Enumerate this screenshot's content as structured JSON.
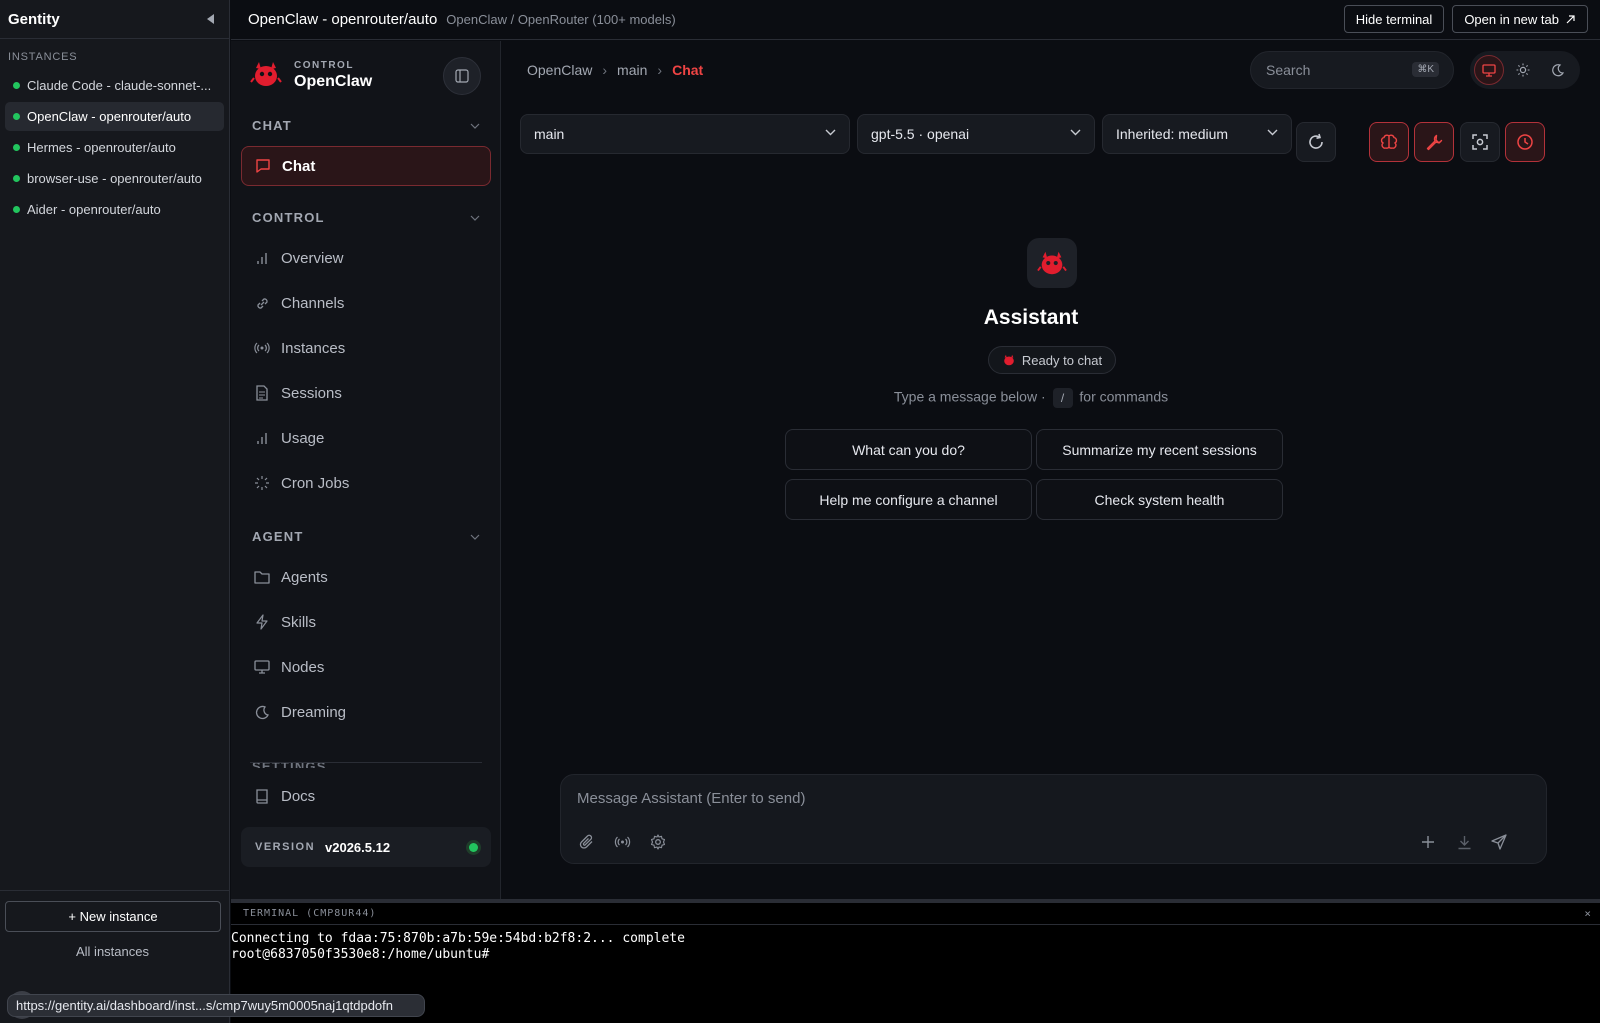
{
  "gentity": {
    "brand": "Gentity",
    "section_label": "INSTANCES",
    "instances": [
      {
        "label": "Claude Code - claude-sonnet-..."
      },
      {
        "label": "OpenClaw - openrouter/auto"
      },
      {
        "label": "Hermes - openrouter/auto"
      },
      {
        "label": "browser-use - openrouter/auto"
      },
      {
        "label": "Aider - openrouter/auto"
      }
    ],
    "new_instance": "+ New instance",
    "all_instances": "All instances"
  },
  "topbar": {
    "title": "OpenClaw - openrouter/auto",
    "subtitle": "OpenClaw / OpenRouter (100+ models)",
    "hide_terminal": "Hide terminal",
    "open_new_tab": "Open in new tab"
  },
  "nav": {
    "control_small": "CONTROL",
    "app_name": "OpenClaw",
    "groups": {
      "chat": "CHAT",
      "control": "CONTROL",
      "agent": "AGENT",
      "settings": "SETTINGS"
    },
    "items": {
      "chat": "Chat",
      "overview": "Overview",
      "channels": "Channels",
      "instances": "Instances",
      "sessions": "Sessions",
      "usage": "Usage",
      "cron_jobs": "Cron Jobs",
      "agents": "Agents",
      "skills": "Skills",
      "nodes": "Nodes",
      "dreaming": "Dreaming",
      "docs": "Docs"
    },
    "version_label": "VERSION",
    "version_value": "v2026.5.12"
  },
  "main": {
    "breadcrumb": [
      "OpenClaw",
      "main",
      "Chat"
    ],
    "search_placeholder": "Search",
    "search_shortcut": "⌘K",
    "session_select": "main",
    "model_select": "gpt-5.5 · openai",
    "thinking_select": "Inherited: medium",
    "divider_char": "|",
    "assistant_name": "Assistant",
    "ready_text": "Ready to chat",
    "hint_before": "Type a message below ·",
    "hint_key": "/",
    "hint_after": "for commands",
    "suggestions": [
      "What can you do?",
      "Summarize my recent sessions",
      "Help me configure a channel",
      "Check system health"
    ],
    "composer_placeholder": "Message Assistant (Enter to send)"
  },
  "terminal": {
    "header": "TERMINAL (CMP8UR44)",
    "close": "×",
    "lines": [
      "Connecting to fdaa:75:870b:a7b:59e:54bd:b2f8:2... complete",
      "root@6837050f3530e8:/home/ubuntu#"
    ]
  },
  "statusbar": {
    "url": "https://gentity.ai/dashboard/inst...s/cmp7wuy5m0005naj1qtdpdofn"
  },
  "colors": {
    "accent": "#ef4444",
    "online": "#22c55e",
    "background": "#0b0d12"
  },
  "icons": {
    "collapse": "triangle-left-icon",
    "sidebar_toggle": "sidebar-panel-icon",
    "chat": "message-square-icon",
    "overview": "bar-chart-icon",
    "channels": "link-icon",
    "instances": "broadcast-icon",
    "sessions": "file-text-icon",
    "usage": "bar-chart-icon",
    "cron_jobs": "loader-icon",
    "agents": "folder-icon",
    "skills": "zap-icon",
    "nodes": "monitor-icon",
    "dreaming": "moon-icon",
    "docs": "book-icon"
  }
}
